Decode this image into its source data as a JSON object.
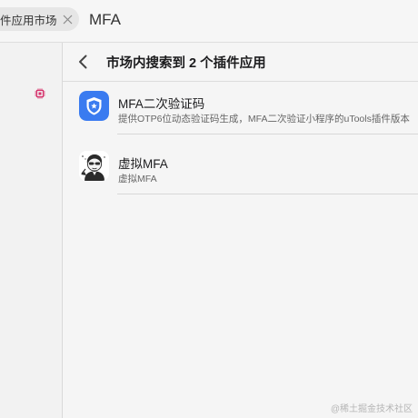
{
  "search": {
    "scope_chip": "件应用市场",
    "query": "MFA"
  },
  "sidebar": {
    "icon": "chip-icon",
    "icon_color": "#d6336c"
  },
  "header": {
    "title": "市场内搜索到 2 个插件应用"
  },
  "results": [
    {
      "name": "MFA二次验证码",
      "description": "提供OTP6位动态验证码生成，MFA二次验证小程序的uTools插件版本",
      "icon": "shield-star-icon",
      "icon_color": "#3a7bf0"
    },
    {
      "name": "虚拟MFA",
      "description": "虚拟MFA",
      "icon": "cartoon-avatar-icon"
    }
  ],
  "watermark": "@稀土掘金技术社区"
}
